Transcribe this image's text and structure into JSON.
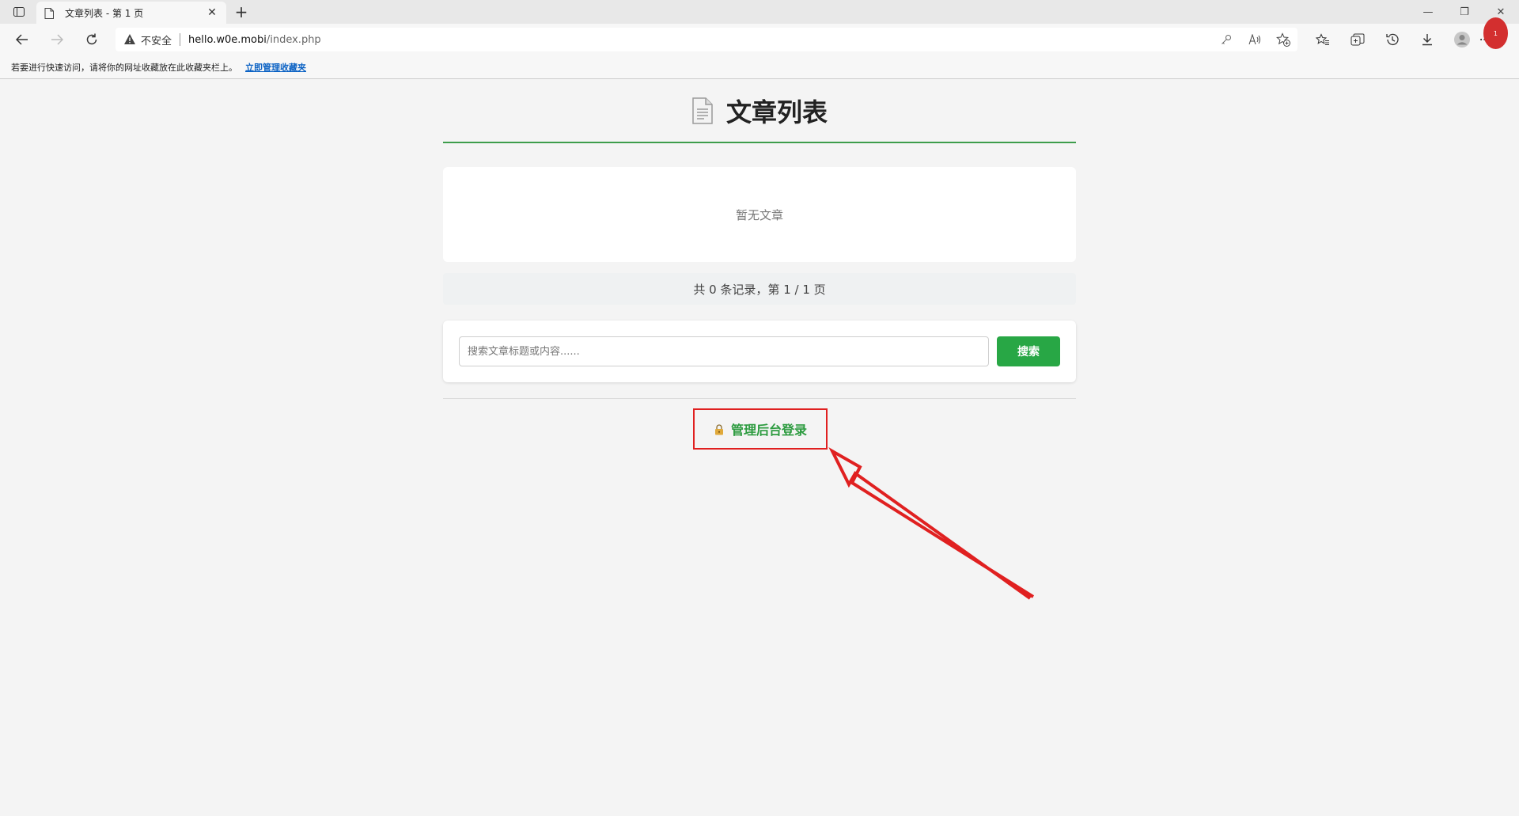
{
  "browser": {
    "tab": {
      "title": "文章列表 - 第 1 页",
      "close": "✕"
    },
    "new_tab": "+",
    "window_controls": {
      "minimize": "—",
      "restore": "❐",
      "close": "✕"
    },
    "address": {
      "security_label": "不安全",
      "url_host": "hello.w0e.mobi",
      "url_path": "/index.php"
    },
    "favorites_bar": {
      "prompt": "若要进行快速访问，请将你的网址收藏放在此收藏夹栏上。",
      "link": "立即管理收藏夹"
    },
    "notification_badge": "1"
  },
  "page": {
    "title": "文章列表",
    "empty_message": "暂无文章",
    "pagination": "共 0 条记录，第 1 / 1 页",
    "search": {
      "placeholder": "搜索文章标题或内容......",
      "button": "搜索"
    },
    "admin_login": "管理后台登录"
  },
  "colors": {
    "accent_green": "#28a745",
    "title_underline": "#3d9d4b",
    "annotation_red": "#e02020",
    "page_background": "#f4f4f4"
  }
}
